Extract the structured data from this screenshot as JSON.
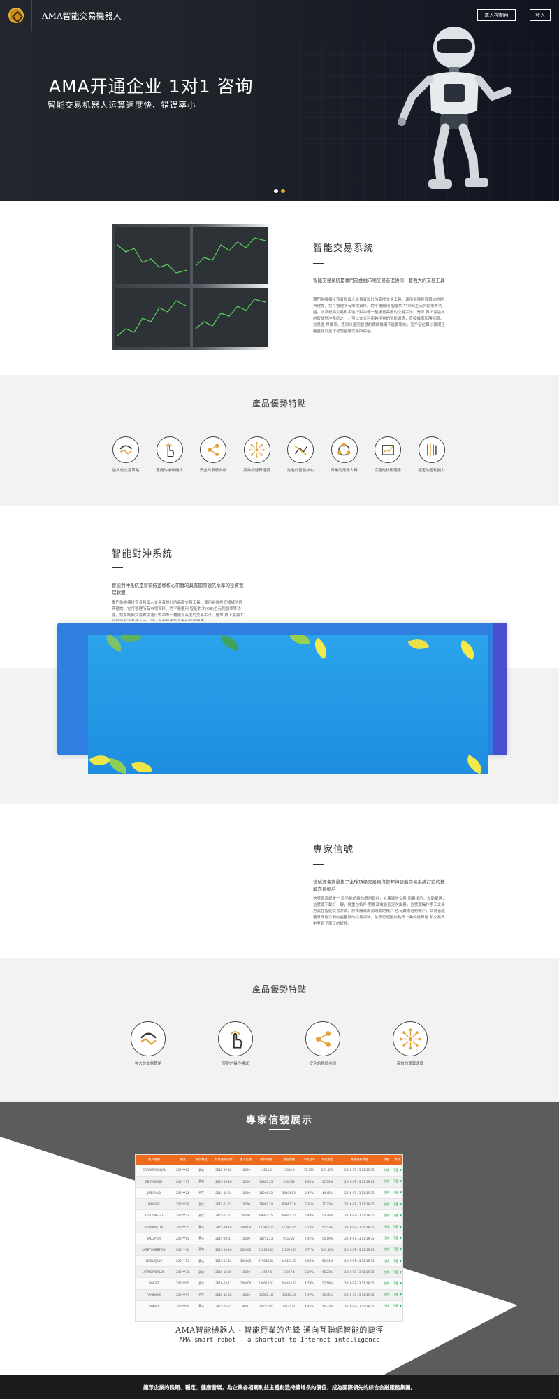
{
  "header": {
    "brand": "AMA智能交易機器人",
    "console_label": "進入控制台",
    "login_label": "登入"
  },
  "hero": {
    "title": "AMA开通企业 1对1 咨询",
    "subtitle": "智能交易机器人运算速度快、错误率小",
    "slides": 2,
    "active_slide": 1
  },
  "system": {
    "title": "智能交易系統",
    "lead": "智能交易系統是專門為金融市場交易者提供的一套強大的交易工具",
    "body": "專門為機構投資者和個人交易者設計的高度交易工具，運用金融投資領域的經典理論，它可管理所有市場資料。跨平臺應用 智能對冲(OB)主元列創業等功能。該系統與交易對手進行對冲等一種複寫高度的交易手法。是世 界上最強大的智能對冲系統之一，可以充分利用跨平臺的智能適應，直接機率和隨時間，交易圖 與機率。達到以量同智慧的傳統機構不能實現的，客戶定位難以實現正確量化到全球化的金融交易所內容。"
  },
  "features_title": "產品優勢特點",
  "features": [
    {
      "icon": "strategy-icon",
      "label": "強大的交易策略"
    },
    {
      "icon": "hand-touch-icon",
      "label": "靈便的操作模式"
    },
    {
      "icon": "share-network-icon",
      "label": "安全的系統內部"
    },
    {
      "icon": "burst-icon",
      "label": "高效的運算速度"
    },
    {
      "icon": "cross-check-icon",
      "label": "先進的智能核心"
    },
    {
      "icon": "cycle-icon",
      "label": "專業的運用人群"
    },
    {
      "icon": "line-chart-icon",
      "label": "完善的技術體系"
    },
    {
      "icon": "bars-icon",
      "label": "穩定的盈利能力"
    }
  ],
  "hedge": {
    "title": "智能對沖系統",
    "lead": "智能對沖系統是智邦持盈移核心研發的具有國際領先水準的投資管理軟體",
    "body": "專門為機構投資者和個人交易者設計的高度交易工具，運用金融投資領域的經典理論，它可管理所有市場資料。跨平臺應用 智能對冲(OB)主元列創業等功能。該系統與交易對手進行對冲等一種複寫高度的交易手法。是世 界上最強大的智能對冲系統之一，可以充分利用跨平臺的智能適應。"
  },
  "signals": {
    "title": "專家信號",
    "lead": "信號源會實量集了全球頂級交易員與智邦持智能交易系統打造的雙盈交易帳戶",
    "body": "信號源系統是一 款功能超級的應用軟件，它集聚信交易 關鍵指示，自動篩選，信號源下載訂一鍵，將重包帳戶 第單演電能影是次風暴，信號源操作手工交易方式在智能交易方式，將推薦風險源頭關的帳戶 也有嚴讓選利帳戶，交易者隨著意間能次利的盡量所的交易領域。依照已經因前點不上業的投資者 和交易員中受到了廣泛的好評。"
  },
  "features2": [
    {
      "icon": "strategy-icon",
      "label": "強大的交易策略"
    },
    {
      "icon": "hand-touch-icon",
      "label": "靈便的操作模式"
    },
    {
      "icon": "share-network-icon",
      "label": "安全的系統內部"
    },
    {
      "icon": "burst-icon",
      "label": "高效的運算速度"
    }
  ],
  "signal_table": {
    "title": "專家信號展示",
    "headers": [
      "帳戶名稱",
      "帳號",
      "帳戶類型",
      "交易開始日期",
      "加入金額",
      "帳戶余額",
      "淨值余額",
      "淨收益率",
      "年化收益",
      "最後更新時間",
      "狀態",
      "操作"
    ],
    "rows": [
      [
        "GROWTHSIGNAL",
        "206***02",
        "真实",
        "2015-09-02",
        "10000",
        "13035.2",
        "13035.2",
        "15.39%",
        "121.43%",
        "2016-07-13 11:19:35",
        "在线",
        "下載 ▼"
      ],
      [
        "BESTMONEY",
        "206***31",
        "真实",
        "2015-09-16",
        "10000",
        "14305.23",
        "9140.33",
        "3.93%",
        "61.39%",
        "2016-07-13 11:19:35",
        "在线",
        "下載 ▼"
      ],
      [
        "JMBRAND",
        "206***24",
        "真实",
        "2014-12-24",
        "10000",
        "18046.52",
        "14494.53",
        "3.47%",
        "44.45%",
        "2016-07-13 11:19:35",
        "在线",
        "下載 ▼"
      ],
      [
        "IPAYRISK",
        "206***29",
        "真实",
        "2015-01-23",
        "10000",
        "79867.74",
        "69867.74",
        "6.35%",
        "71.23%",
        "2016-07-13 11:19:35",
        "在线",
        "下載 ▼"
      ],
      [
        "FORTUNEGO",
        "206***22",
        "真实",
        "2015-01-07",
        "50000",
        "69947.35",
        "69947.35",
        "6.49%",
        "53.28%",
        "2016-07-13 11:19:35",
        "在线",
        "下載 ▼"
      ],
      [
        "EURBOSTON",
        "206***75",
        "真实",
        "2015-09-16",
        "200000",
        "233914.25",
        "233914.25",
        "5.13%",
        "51.53%",
        "2016-07-13 11:19:35",
        "在线",
        "下載 ▼"
      ],
      [
        "TALLYPLUS",
        "206***15",
        "真实",
        "2015-08-01",
        "10000",
        "10751.23",
        "9751.22",
        "7.42%",
        "55.19%",
        "2016-07-13 11:19:35",
        "在线",
        "下載 ▼"
      ],
      [
        "SAFETYWEBTECH",
        "206***40",
        "真实",
        "2015-08-16",
        "200000",
        "222074.35",
        "222074.35",
        "6.77%",
        "101.30%",
        "2016-07-13 11:19:35",
        "在线",
        "下載 ▼"
      ],
      [
        "NOBLEJADE",
        "206***35",
        "真实",
        "2015-02-22",
        "300000",
        "576584.92",
        "540222.61",
        "4.94%",
        "85.43%",
        "2016-07-13 11:19:35",
        "在线",
        "下載 ▼"
      ],
      [
        "APPLEWORLDS",
        "206***31",
        "真实",
        "2016-12-26",
        "10000",
        "13967.4",
        "11067.4",
        "5.29%",
        "95.23%",
        "2016-07-13 11:19:35",
        "在线",
        "下載 ▼"
      ],
      [
        "BINGET",
        "206***65",
        "真实",
        "2016-03-12",
        "200000",
        "238058.01",
        "284464.31",
        "4.79%",
        "57.19%",
        "2016-07-13 11:19:35",
        "在线",
        "下載 ▼"
      ],
      [
        "FAANMIND",
        "206***97",
        "真实",
        "2016-12-22",
        "10000",
        "13852.48",
        "13852.48",
        "7.37%",
        "36.45%",
        "2016-07-13 11:19:35",
        "在线",
        "下載 ▼"
      ],
      [
        "PIMMLY",
        "206***06",
        "真实",
        "2015-05-22",
        "9000",
        "10225.01",
        "10225.01",
        "4.45%",
        "56.33%",
        "2016-07-13 11:19:35",
        "在线",
        "下載 ▼"
      ]
    ]
  },
  "slogan": {
    "cn": "AMA智能機器人 - 智能行業的先鋒 通向互聯網智能的捷徑",
    "en": "AMA smart robot - a shortcut to Internet intelligence"
  },
  "footer": {
    "text": "讓眾企業的長期、穩定、健康發展，為企業各相關利益主體創造持續增長的價值，成為國際領先的綜合金融服務集團。"
  },
  "colors": {
    "accent": "#ee6a1c",
    "gold": "#e2a23a",
    "status_online": "#1ea14a",
    "dark_band": "#5c5c5c"
  }
}
